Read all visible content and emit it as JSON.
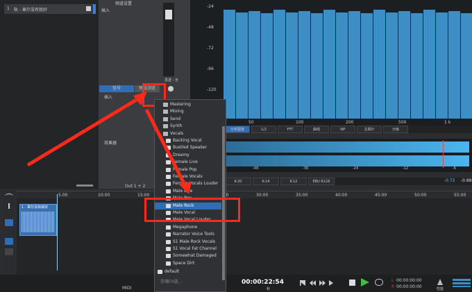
{
  "track": {
    "number": "1",
    "name": "轨 - 章尔没有就好"
  },
  "channel": {
    "header_label": "频道设置",
    "insert_label": "插入",
    "send_label": "发送 : 无",
    "tab_left": "信号",
    "tab_right": "预设浏览",
    "sub_insert": "插入",
    "sub_effects": "效果器",
    "out_label": "Out 1 + 2"
  },
  "menu": {
    "folders": [
      "Mastering",
      "Mixing",
      "Send",
      "Synth",
      "Vocals"
    ],
    "presets": [
      "Backing Vocal",
      "Bustled Speaker",
      "Dreamy",
      "Female Live",
      "Female Pop",
      "Female Vocals",
      "Female Vocals Louder",
      "Male Live",
      "Male Pop",
      "Male Rock",
      "Male Vocal",
      "Male Vocal Louder",
      "Megaphone",
      "Narrator Voice Tools",
      "S1 Male Rock Vocals",
      "S1 Vocal Fat Channel",
      "Somewhat Damaged",
      "Space Dirt"
    ],
    "selected": "Male Rock",
    "default_item": "default",
    "footer": "存储FX链..."
  },
  "spectrum": {
    "db_labels": [
      "-24",
      "-48",
      "-72",
      "-96",
      "-120",
      "-144"
    ],
    "freq_labels": [
      "50",
      "100",
      "200",
      "500",
      "1 k"
    ],
    "bar_levels": [
      0.95,
      0.93,
      0.94,
      0.92,
      0.95,
      0.93,
      0.94,
      0.92,
      0.95,
      0.93,
      0.94,
      0.92,
      0.95,
      0.93,
      0.94,
      0.92,
      0.95,
      0.93,
      0.94,
      0.92
    ],
    "modes": [
      "分析图谱",
      "1/2",
      "FFT",
      "曲线",
      "WF",
      "主频计",
      "分级"
    ]
  },
  "loudness": {
    "scale": [
      "-48",
      "-36",
      "-24",
      "-12",
      "-6"
    ],
    "modes": [
      "K-20",
      "K-14",
      "K-12",
      "EBU R128"
    ],
    "readouts": [
      "-0.72",
      "-0.88"
    ]
  },
  "timeline": {
    "markers": [
      "5.00",
      "10:00",
      "15:00",
      "20:00",
      "25:00",
      "30:00",
      "35:00",
      "40:00",
      "45:00",
      "50:00",
      "55:00"
    ],
    "clip_name": "1 - 章尔没有就好"
  },
  "transport": {
    "time": "00:00:22:54",
    "time_sub": "秒",
    "l_time": "00:00:00:00",
    "r_time": "00:00:00:00",
    "l_label": "L",
    "r_label": "R",
    "midi_label": "MIDI",
    "perf_label": "性能"
  },
  "colors": {
    "accent": "#2f6eb5",
    "highlight": "#ff2a1a",
    "bar": "#3d8ec4",
    "play": "#3fbf3f"
  }
}
